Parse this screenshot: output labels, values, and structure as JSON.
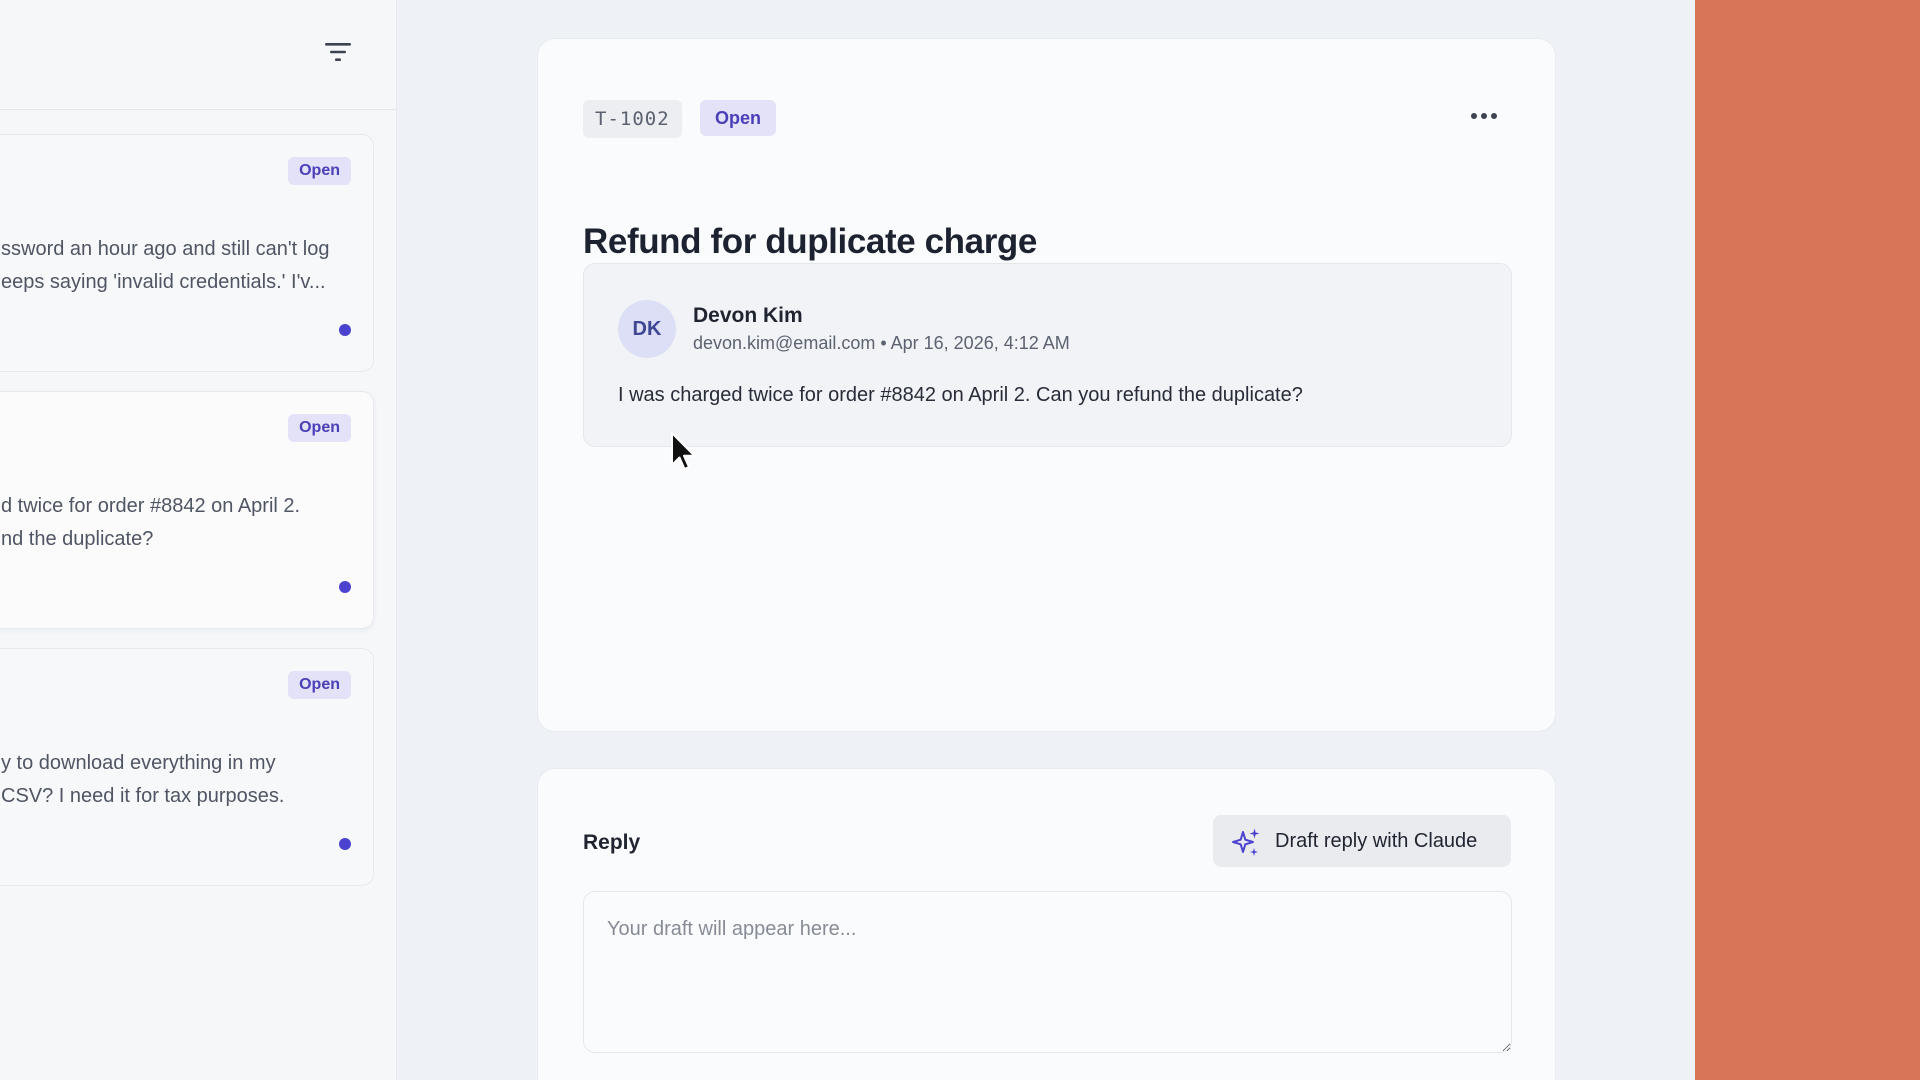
{
  "colors": {
    "accent_panel": "#d87558",
    "badge_bg": "#e3e2f8",
    "badge_text": "#4a3fb8",
    "unread_dot": "#4b43cf"
  },
  "ticket_list": {
    "filter_icon": "filter-icon",
    "tickets": [
      {
        "status": "Open",
        "snippet_lines": [
          "ssword an hour ago and still can't log",
          "eeps saying 'invalid credentials.' I'v..."
        ],
        "unread": true
      },
      {
        "status": "Open",
        "snippet_lines": [
          "d twice for order #8842 on April 2.",
          "nd the duplicate?"
        ],
        "unread": true
      },
      {
        "status": "Open",
        "snippet_lines": [
          "y to download everything in my",
          "CSV? I need it for tax purposes."
        ],
        "unread": true
      }
    ]
  },
  "ticket": {
    "id": "T-1002",
    "status": "Open",
    "more_icon": "more-horizontal-icon",
    "title": "Refund for duplicate charge",
    "message": {
      "avatar_initials": "DK",
      "sender_name": "Devon Kim",
      "sender_meta": "devon.kim@email.com • Apr 16, 2026, 4:12 AM",
      "body": "I was charged twice for order #8842 on April 2. Can you refund the duplicate?"
    }
  },
  "reply": {
    "label": "Reply",
    "draft_button_label": "Draft reply with Claude",
    "draft_button_icon": "sparkle-icon",
    "textarea_placeholder": "Your draft will appear here..."
  }
}
